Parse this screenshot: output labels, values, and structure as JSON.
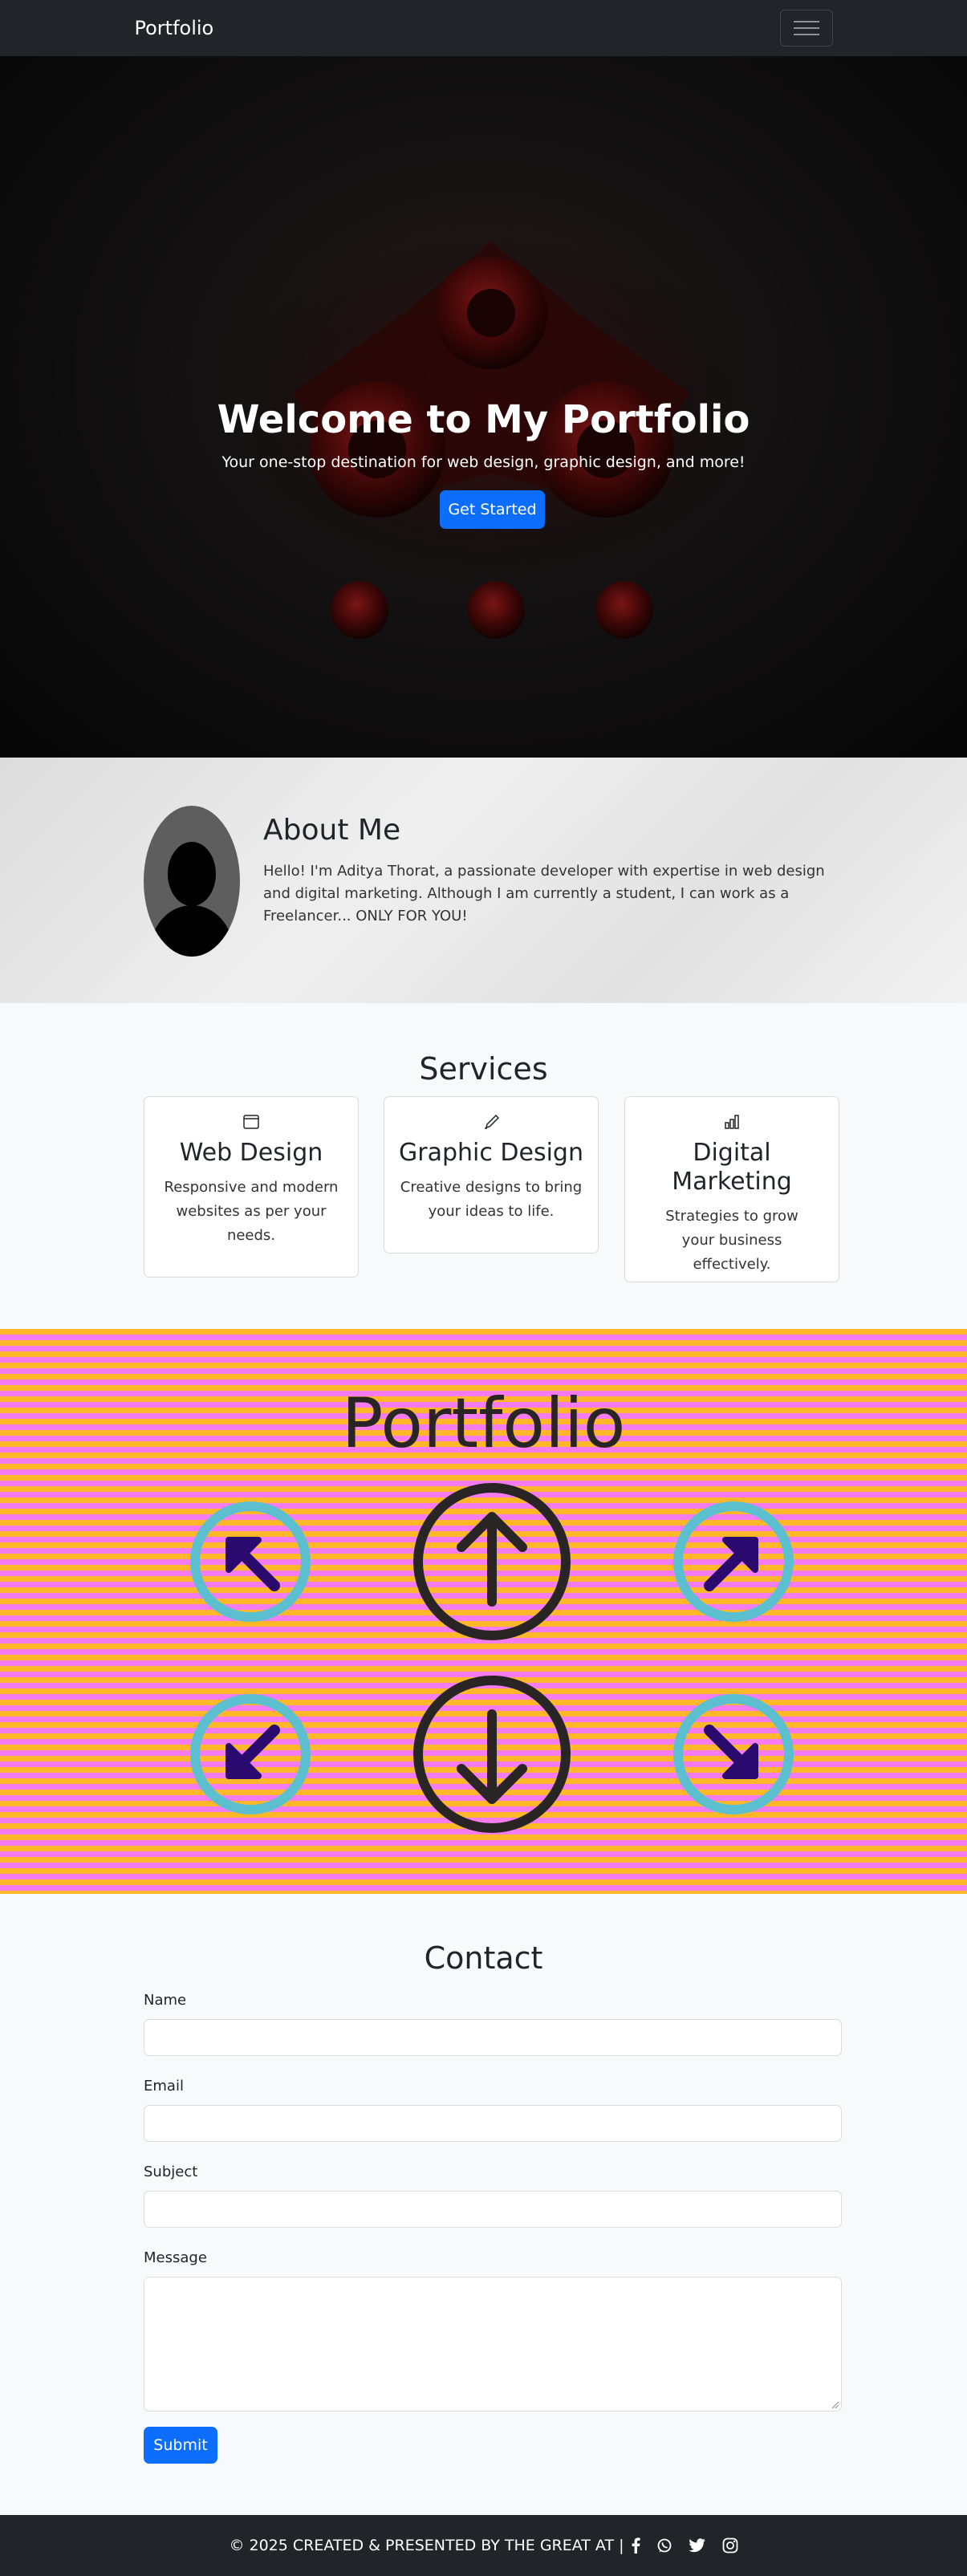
{
  "navbar": {
    "brand": "Portfolio",
    "toggler_icon": "hamburger-icon"
  },
  "hero": {
    "title": "Welcome to My Portfolio",
    "subtitle": "Your one-stop destination for web design, graphic design, and more!",
    "cta_label": "Get Started"
  },
  "about": {
    "title": "About Me",
    "text": "Hello! I'm Aditya Thorat, a passionate developer with expertise in web design and digital marketing. Although I am currently a student, I can work as a Freelancer... ONLY FOR YOU!"
  },
  "services": {
    "title": "Services",
    "items": [
      {
        "icon": "browser-window-icon",
        "title": "Web Design",
        "text": "Responsive and modern websites as per your needs."
      },
      {
        "icon": "brush-icon",
        "title": "Graphic Design",
        "text": "Creative designs to bring your ideas to life."
      },
      {
        "icon": "bar-chart-icon",
        "title": "Digital Marketing",
        "text": "Strategies to grow your business effectively."
      }
    ]
  },
  "portfolio": {
    "title": "Portfolio"
  },
  "contact": {
    "title": "Contact",
    "name_label": "Name",
    "email_label": "Email",
    "subject_label": "Subject",
    "message_label": "Message",
    "submit_label": "Submit"
  },
  "footer": {
    "text": "© 2025 CREATED & PRESENTED BY THE GREAT AT |",
    "social_icons": [
      "facebook-icon",
      "whatsapp-icon",
      "twitter-icon",
      "instagram-icon"
    ]
  },
  "colors": {
    "primary": "#0d6efd",
    "dark": "#212529",
    "stripe_orange": "#ffb72a",
    "stripe_pink": "#f57cf0",
    "arrow_ring": "#5bbfd0",
    "arrow_fill": "#2a0a6e"
  }
}
